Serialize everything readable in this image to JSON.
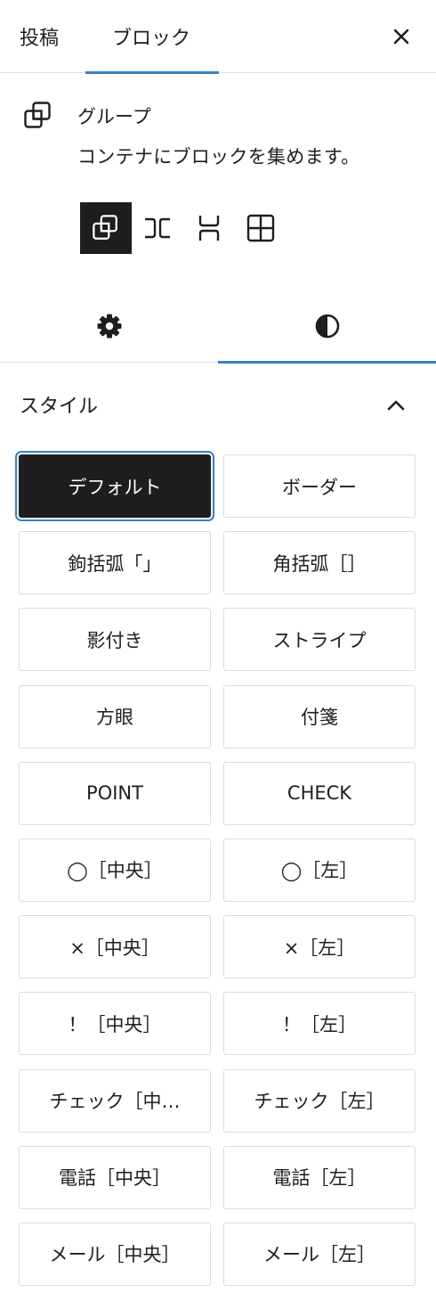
{
  "header": {
    "tabs": [
      {
        "label": "投稿"
      },
      {
        "label": "ブロック"
      }
    ],
    "close_icon": "close-icon"
  },
  "block": {
    "icon": "group-icon",
    "title": "グループ",
    "description": "コンテナにブロックを集めます。",
    "variations": [
      {
        "icon": "group-variation-icon",
        "selected": true
      },
      {
        "icon": "row-variation-icon",
        "selected": false
      },
      {
        "icon": "stack-variation-icon",
        "selected": false
      },
      {
        "icon": "grid-variation-icon",
        "selected": false
      }
    ]
  },
  "panel_tabs": [
    {
      "icon": "gear-icon",
      "selected": false
    },
    {
      "icon": "contrast-icon",
      "selected": true
    }
  ],
  "styles": {
    "title": "スタイル",
    "expanded": true,
    "options": [
      {
        "label": "デフォルト",
        "selected": true
      },
      {
        "label": "ボーダー"
      },
      {
        "label": "鉤括弧「」"
      },
      {
        "label": "角括弧［］"
      },
      {
        "label": "影付き"
      },
      {
        "label": "ストライプ"
      },
      {
        "label": "方眼"
      },
      {
        "label": "付箋"
      },
      {
        "label": "POINT"
      },
      {
        "label": "CHECK"
      },
      {
        "label": "◯［中央］"
      },
      {
        "label": "◯［左］"
      },
      {
        "label": "×［中央］"
      },
      {
        "label": "×［左］"
      },
      {
        "label": "！［中央］"
      },
      {
        "label": "！［左］"
      },
      {
        "label": "チェック［中…"
      },
      {
        "label": "チェック［左］"
      },
      {
        "label": "電話［中央］"
      },
      {
        "label": "電話［左］"
      },
      {
        "label": "メール［中央］"
      },
      {
        "label": "メール［左］"
      }
    ]
  },
  "colors": {
    "accent": "#3582c4",
    "dark": "#1e1e1e",
    "border": "#dcdcde"
  }
}
